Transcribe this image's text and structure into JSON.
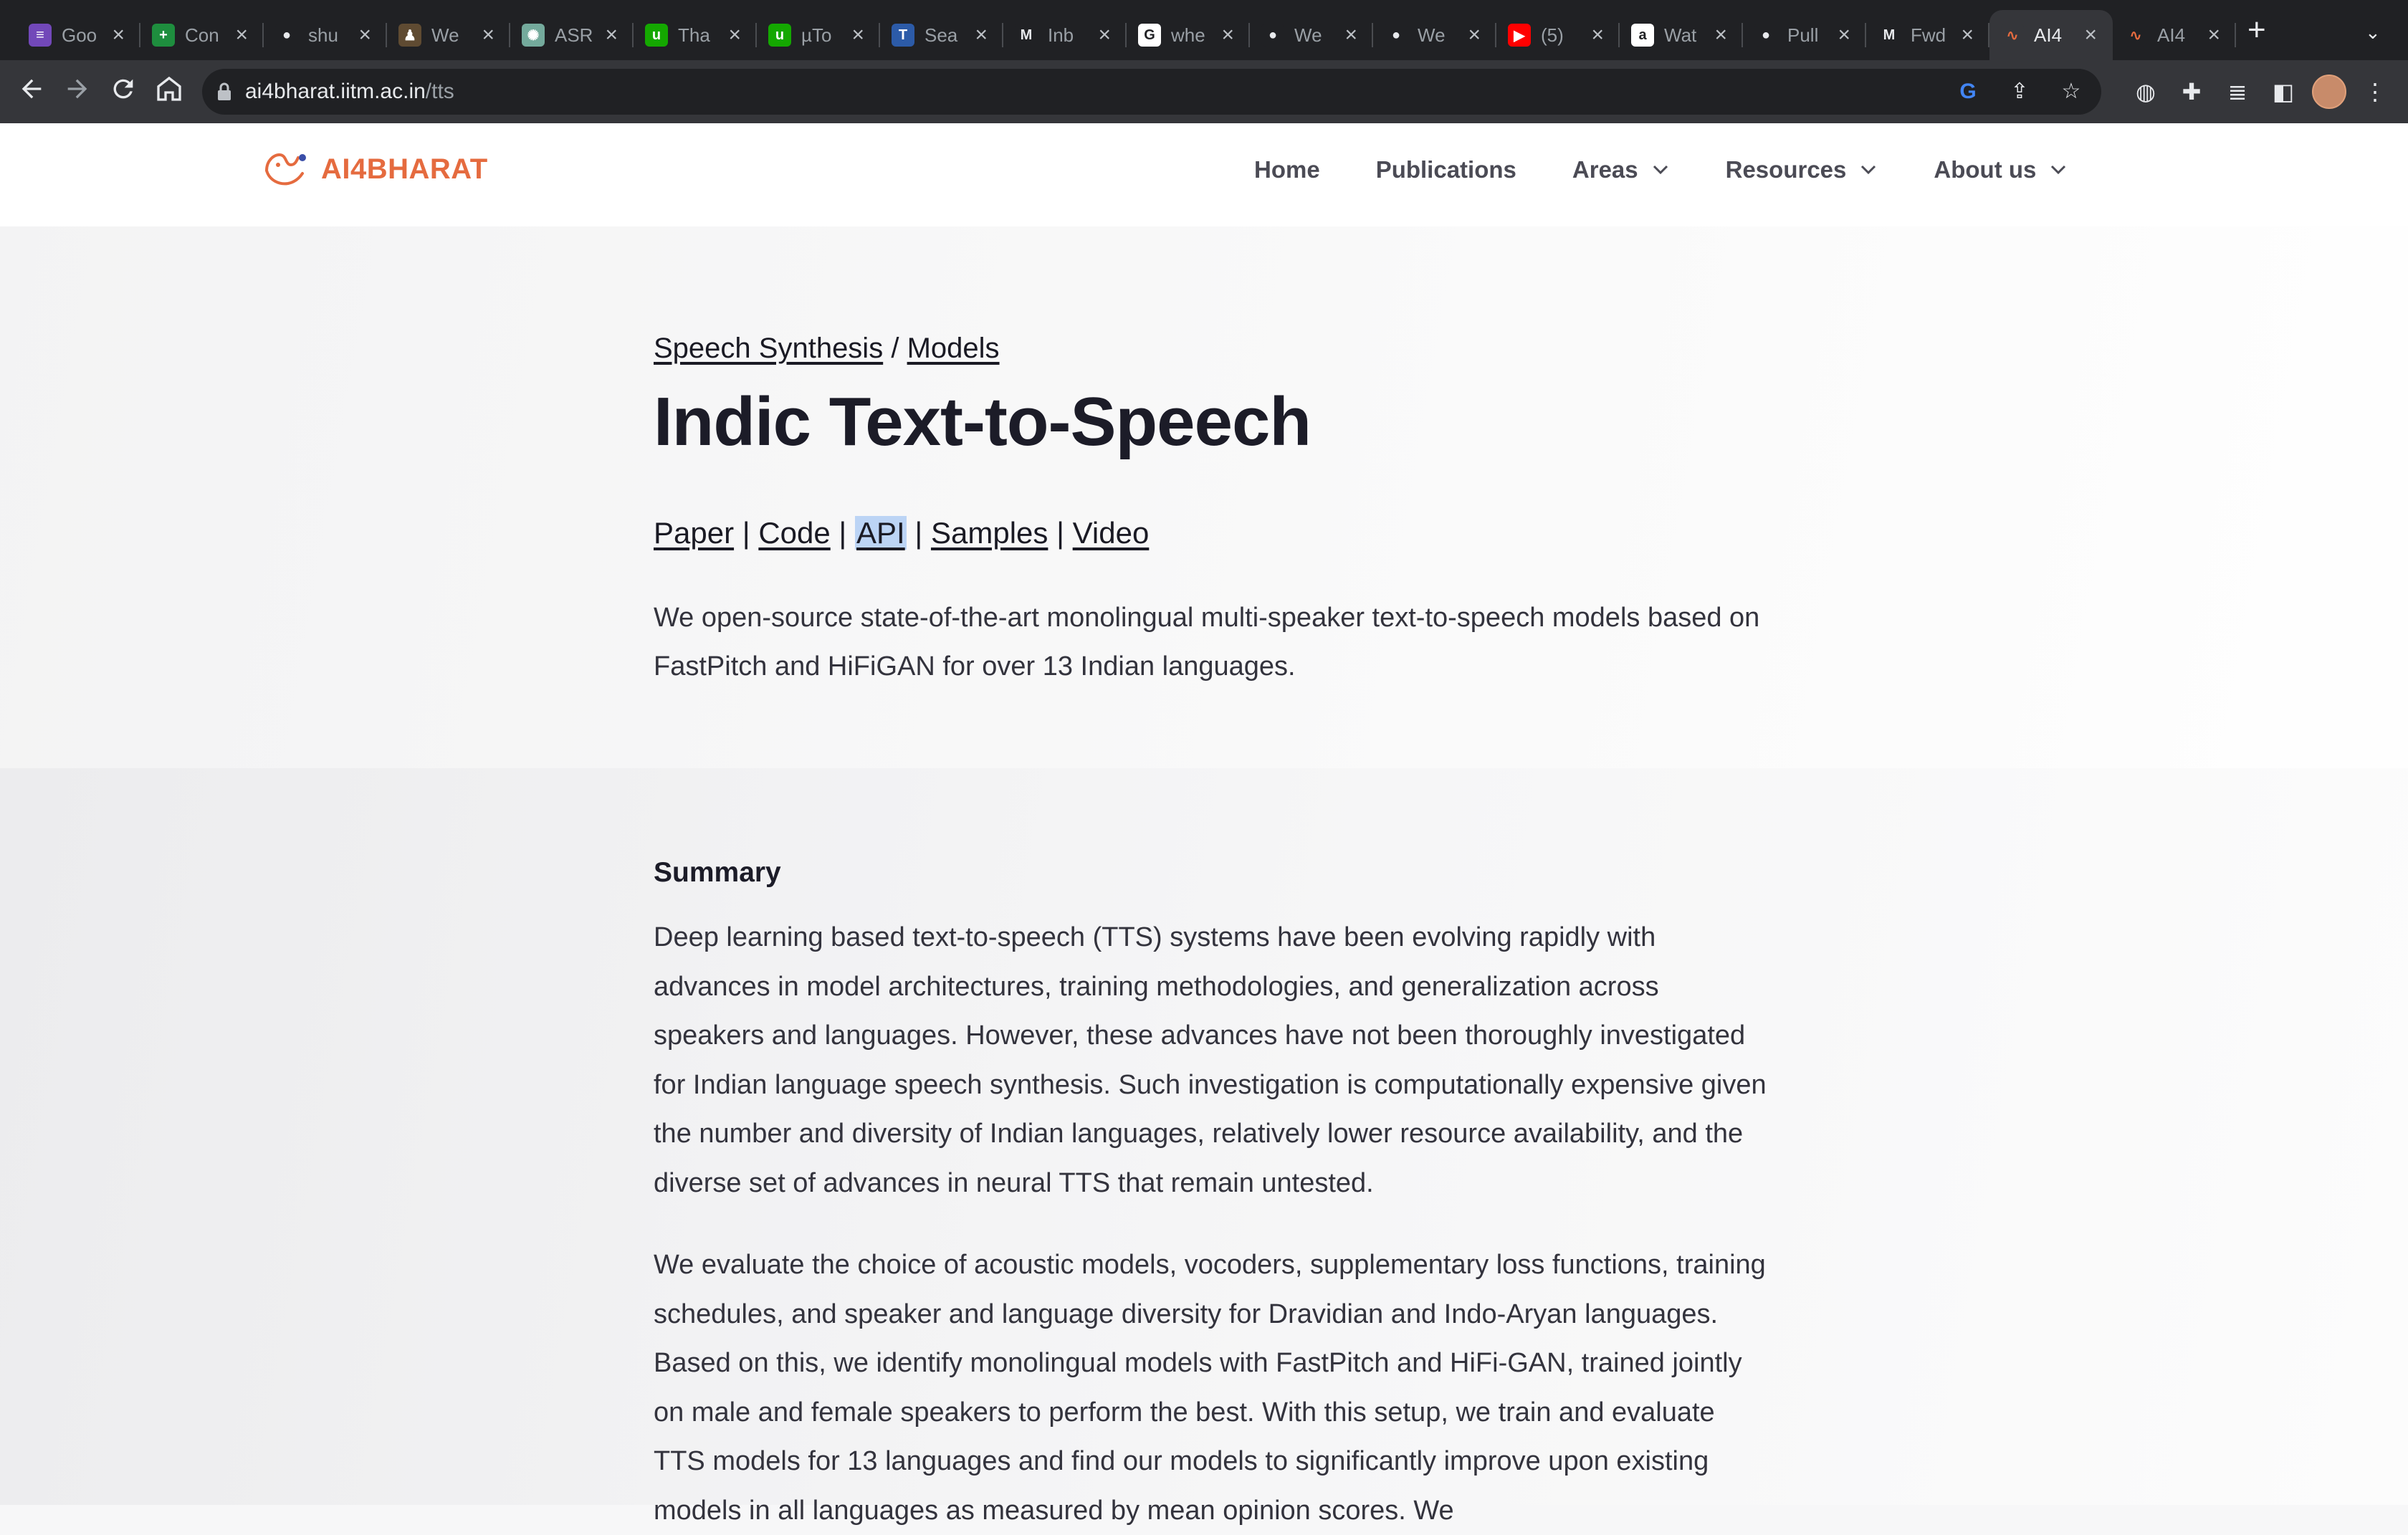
{
  "browser": {
    "tabs": [
      {
        "title": "Goo",
        "icon": "forms-icon",
        "color": "#7248b9",
        "glyph": "≡"
      },
      {
        "title": "Con",
        "icon": "sheets-icon",
        "color": "#1e8e3e",
        "glyph": "+"
      },
      {
        "title": "shu",
        "icon": "github-icon",
        "color": "#202124",
        "glyph": "●"
      },
      {
        "title": "We",
        "icon": "app-icon",
        "color": "#5f4b32",
        "glyph": "♟"
      },
      {
        "title": "ASR",
        "icon": "openai-icon",
        "color": "#74aa9c",
        "glyph": "✺"
      },
      {
        "title": "Tha",
        "icon": "upwork-icon",
        "color": "#14a800",
        "glyph": "u"
      },
      {
        "title": "µTo",
        "icon": "upwork-icon",
        "color": "#14a800",
        "glyph": "u"
      },
      {
        "title": "Sea",
        "icon": "tensorflow-icon",
        "color": "#2c5ba8",
        "glyph": "T"
      },
      {
        "title": "Inb",
        "icon": "gmail-icon",
        "color": "#202124",
        "glyph": "M"
      },
      {
        "title": "whe",
        "icon": "google-icon",
        "color": "#ffffff",
        "glyph": "G"
      },
      {
        "title": "We",
        "icon": "github-icon",
        "color": "#202124",
        "glyph": "●"
      },
      {
        "title": "We",
        "icon": "github-icon",
        "color": "#202124",
        "glyph": "●"
      },
      {
        "title": "(5)",
        "icon": "youtube-icon",
        "color": "#ff0000",
        "glyph": "▶"
      },
      {
        "title": "Wat",
        "icon": "amazon-icon",
        "color": "#ffffff",
        "glyph": "a"
      },
      {
        "title": "Pull",
        "icon": "github-icon",
        "color": "#202124",
        "glyph": "●"
      },
      {
        "title": "Fwd",
        "icon": "gmail-icon",
        "color": "#202124",
        "glyph": "M"
      },
      {
        "title": "AI4",
        "icon": "ai4bharat-icon",
        "color": "#35363a",
        "glyph": "∿",
        "active": true
      },
      {
        "title": "AI4",
        "icon": "ai4bharat-icon",
        "color": "#202124",
        "glyph": "∿"
      }
    ],
    "url_host": "ai4bharat.iitm.ac.in",
    "url_path": "/tts"
  },
  "site": {
    "logo_text": "AI4BHARAT",
    "brand_color": "#e56b3f",
    "nav": {
      "home": "Home",
      "publications": "Publications",
      "areas": "Areas",
      "resources": "Resources",
      "about": "About us"
    }
  },
  "hero": {
    "breadcrumb_1": "Speech Synthesis",
    "breadcrumb_sep": "/",
    "breadcrumb_2": "Models",
    "title": "Indic Text-to-Speech",
    "links": {
      "paper": "Paper",
      "code": "Code",
      "api": "API",
      "samples": "Samples",
      "video": "Video",
      "sep": "|"
    },
    "intro": "We open-source state-of-the-art monolingual multi-speaker text-to-speech models based on FastPitch and HiFiGAN for over 13 Indian languages."
  },
  "summary": {
    "heading": "Summary",
    "paragraph_1": "Deep learning based text-to-speech (TTS) systems have been evolving rapidly with advances in model architectures, training methodologies, and generalization across speakers and languages. However, these advances have not been thoroughly investigated for Indian language speech synthesis. Such investigation is computationally expensive given the number and diversity of Indian languages, relatively lower resource availability, and the diverse set of advances in neural TTS that remain untested.",
    "paragraph_2": "We evaluate the choice of acoustic models, vocoders, supplementary loss functions, training schedules, and speaker and language diversity for Dravidian and Indo-Aryan languages. Based on this, we identify monolingual models with FastPitch and HiFi-GAN, trained jointly on male and female speakers to perform the best. With this setup, we train and evaluate TTS models for 13 languages and find our models to significantly improve upon existing models in all languages as measured by mean opinion scores. We"
  }
}
